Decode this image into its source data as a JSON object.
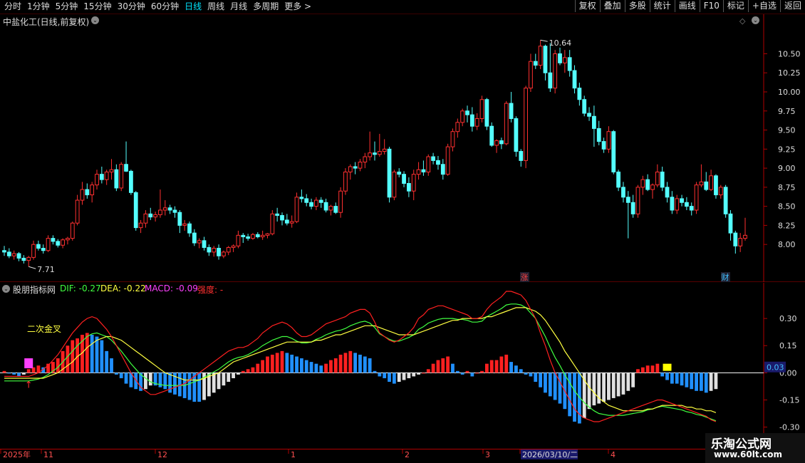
{
  "topbar": {
    "tabs": [
      {
        "label": "分时",
        "active": false
      },
      {
        "label": "1分钟",
        "active": false
      },
      {
        "label": "5分钟",
        "active": false
      },
      {
        "label": "15分钟",
        "active": false
      },
      {
        "label": "30分钟",
        "active": false
      },
      {
        "label": "60分钟",
        "active": false
      },
      {
        "label": "日线",
        "active": true
      },
      {
        "label": "周线",
        "active": false
      },
      {
        "label": "月线",
        "active": false
      },
      {
        "label": "多周期",
        "active": false
      },
      {
        "label": "更多 >",
        "active": false
      }
    ],
    "right_buttons": [
      "复权",
      "叠加",
      "多股",
      "统计",
      "画线",
      "F10",
      "标记",
      "+自选",
      "返回"
    ]
  },
  "main_chart": {
    "stock_title": "中盐化工(日线,前复权)",
    "high_marker": "10.64",
    "low_marker": "7.71",
    "event_badges": [
      {
        "text": "涨",
        "color": "#ff4040"
      },
      {
        "text": "财",
        "color": "#40c0ff"
      }
    ],
    "price_ticks": [
      "10.50",
      "10.25",
      "10.00",
      "9.75",
      "9.50",
      "9.25",
      "9.00",
      "8.75",
      "8.50",
      "8.25",
      "8.00"
    ],
    "colors": {
      "up": "#ff3030",
      "down": "#54ffff"
    }
  },
  "indicator": {
    "name": "股朋指标网",
    "dif_label": "DIF: -0.27",
    "dea_label": "DEA: -0.22",
    "macd_label": "MACD: -0.09",
    "strength_label": "强度: -",
    "annotation": "二次金叉",
    "current_value": "0.03",
    "ticks": [
      "0.30",
      "0.15",
      "0.00",
      "-0.15",
      "-0.30"
    ],
    "colors": {
      "dif": "#ff2020",
      "dea": "#ffff40",
      "mid": "#40ff40",
      "bar_up": "#ff2020",
      "bar_down": "#2090ff",
      "bar_weak": "#e0e0e0"
    }
  },
  "xaxis": {
    "labels": [
      "2025年",
      "11",
      "12",
      "1",
      "2",
      "3",
      "2026/03/10/二",
      "4"
    ]
  },
  "watermark": {
    "line1": "乐淘公式网",
    "line2": "www.60lt.com"
  },
  "chart_data": {
    "type": "candlestick",
    "ylim": [
      7.6,
      10.85
    ],
    "candles": [
      [
        7.92,
        7.98,
        7.85,
        7.9
      ],
      [
        7.9,
        7.95,
        7.82,
        7.85
      ],
      [
        7.85,
        7.92,
        7.8,
        7.88
      ],
      [
        7.88,
        7.9,
        7.78,
        7.82
      ],
      [
        7.82,
        7.86,
        7.75,
        7.79
      ],
      [
        7.79,
        7.85,
        7.71,
        7.83
      ],
      [
        7.83,
        8.05,
        7.8,
        8.0
      ],
      [
        8.0,
        8.05,
        7.92,
        7.95
      ],
      [
        7.95,
        8.0,
        7.88,
        7.92
      ],
      [
        7.92,
        8.12,
        7.9,
        8.08
      ],
      [
        8.08,
        8.12,
        8.0,
        8.04
      ],
      [
        8.04,
        8.07,
        7.96,
        7.99
      ],
      [
        7.99,
        8.08,
        7.95,
        8.06
      ],
      [
        8.06,
        8.1,
        8.0,
        8.08
      ],
      [
        8.08,
        8.3,
        8.05,
        8.28
      ],
      [
        8.28,
        8.65,
        8.25,
        8.58
      ],
      [
        8.58,
        8.82,
        8.52,
        8.72
      ],
      [
        8.72,
        8.8,
        8.6,
        8.65
      ],
      [
        8.65,
        8.82,
        8.55,
        8.78
      ],
      [
        8.78,
        8.98,
        8.72,
        8.92
      ],
      [
        8.92,
        9.02,
        8.8,
        8.85
      ],
      [
        8.85,
        8.98,
        8.78,
        8.95
      ],
      [
        8.95,
        9.12,
        8.85,
        8.98
      ],
      [
        8.98,
        9.05,
        8.7,
        8.74
      ],
      [
        8.74,
        9.08,
        8.7,
        9.05
      ],
      [
        9.05,
        9.35,
        8.95,
        8.96
      ],
      [
        8.96,
        8.98,
        8.65,
        8.68
      ],
      [
        8.68,
        8.7,
        8.18,
        8.22
      ],
      [
        8.22,
        8.32,
        8.15,
        8.28
      ],
      [
        8.28,
        8.45,
        8.22,
        8.4
      ],
      [
        8.4,
        8.48,
        8.32,
        8.36
      ],
      [
        8.36,
        8.43,
        8.3,
        8.39
      ],
      [
        8.39,
        8.72,
        8.35,
        8.45
      ],
      [
        8.45,
        8.58,
        8.38,
        8.48
      ],
      [
        8.48,
        8.52,
        8.4,
        8.45
      ],
      [
        8.45,
        8.5,
        8.35,
        8.42
      ],
      [
        8.42,
        8.45,
        8.15,
        8.25
      ],
      [
        8.25,
        8.32,
        8.18,
        8.27
      ],
      [
        8.27,
        8.3,
        8.1,
        8.15
      ],
      [
        8.15,
        8.2,
        7.98,
        8.02
      ],
      [
        8.02,
        8.08,
        7.95,
        8.05
      ],
      [
        8.05,
        8.1,
        7.92,
        7.96
      ],
      [
        7.96,
        8.0,
        7.85,
        7.9
      ],
      [
        7.9,
        7.98,
        7.84,
        7.95
      ],
      [
        7.95,
        8.0,
        7.8,
        7.85
      ],
      [
        7.85,
        7.92,
        7.82,
        7.9
      ],
      [
        7.9,
        7.98,
        7.86,
        7.96
      ],
      [
        7.96,
        8.0,
        7.9,
        7.98
      ],
      [
        7.98,
        8.18,
        7.95,
        8.12
      ],
      [
        8.12,
        8.15,
        8.02,
        8.1
      ],
      [
        8.1,
        8.14,
        8.05,
        8.08
      ],
      [
        8.08,
        8.15,
        8.06,
        8.13
      ],
      [
        8.13,
        8.16,
        8.08,
        8.1
      ],
      [
        8.1,
        8.18,
        8.06,
        8.12
      ],
      [
        8.12,
        8.15,
        8.08,
        8.14
      ],
      [
        8.14,
        8.45,
        8.12,
        8.4
      ],
      [
        8.4,
        8.48,
        8.3,
        8.38
      ],
      [
        8.38,
        8.42,
        8.25,
        8.32
      ],
      [
        8.32,
        8.4,
        8.25,
        8.28
      ],
      [
        8.28,
        8.38,
        8.22,
        8.3
      ],
      [
        8.3,
        8.68,
        8.28,
        8.62
      ],
      [
        8.62,
        8.72,
        8.55,
        8.6
      ],
      [
        8.6,
        8.66,
        8.5,
        8.55
      ],
      [
        8.55,
        8.6,
        8.46,
        8.5
      ],
      [
        8.5,
        8.62,
        8.45,
        8.58
      ],
      [
        8.58,
        8.62,
        8.48,
        8.55
      ],
      [
        8.55,
        8.6,
        8.42,
        8.45
      ],
      [
        8.45,
        8.52,
        8.38,
        8.5
      ],
      [
        8.5,
        8.55,
        8.4,
        8.42
      ],
      [
        8.42,
        8.75,
        8.35,
        8.7
      ],
      [
        8.7,
        9.0,
        8.65,
        8.95
      ],
      [
        8.95,
        9.05,
        8.85,
        9.02
      ],
      [
        9.02,
        9.08,
        8.92,
        9.0
      ],
      [
        9.0,
        9.12,
        8.96,
        9.08
      ],
      [
        9.08,
        9.2,
        9.0,
        9.15
      ],
      [
        9.15,
        9.48,
        9.1,
        9.2
      ],
      [
        9.2,
        9.35,
        9.1,
        9.18
      ],
      [
        9.18,
        9.45,
        9.15,
        9.22
      ],
      [
        9.22,
        9.38,
        9.18,
        9.25
      ],
      [
        9.25,
        9.28,
        8.55,
        8.62
      ],
      [
        8.62,
        8.98,
        8.58,
        8.95
      ],
      [
        8.95,
        9.0,
        8.88,
        8.92
      ],
      [
        8.92,
        8.96,
        8.75,
        8.8
      ],
      [
        8.8,
        8.88,
        8.62,
        8.7
      ],
      [
        8.7,
        8.98,
        8.58,
        8.92
      ],
      [
        8.92,
        9.08,
        8.85,
        8.98
      ],
      [
        8.98,
        9.1,
        8.9,
        8.95
      ],
      [
        8.95,
        9.18,
        8.9,
        9.15
      ],
      [
        9.15,
        9.2,
        9.05,
        9.1
      ],
      [
        9.1,
        9.16,
        8.98,
        9.05
      ],
      [
        9.05,
        9.12,
        8.85,
        8.92
      ],
      [
        8.92,
        9.32,
        8.9,
        9.28
      ],
      [
        9.28,
        9.52,
        9.22,
        9.48
      ],
      [
        9.48,
        9.65,
        9.4,
        9.6
      ],
      [
        9.6,
        9.78,
        9.55,
        9.75
      ],
      [
        9.75,
        9.82,
        9.6,
        9.7
      ],
      [
        9.7,
        9.8,
        9.48,
        9.55
      ],
      [
        9.55,
        9.72,
        9.5,
        9.65
      ],
      [
        9.65,
        9.95,
        9.6,
        9.9
      ],
      [
        9.9,
        9.92,
        9.5,
        9.55
      ],
      [
        9.55,
        9.6,
        9.28,
        9.3
      ],
      [
        9.3,
        9.38,
        9.2,
        9.36
      ],
      [
        9.36,
        9.4,
        9.25,
        9.32
      ],
      [
        9.32,
        9.88,
        9.3,
        9.85
      ],
      [
        9.85,
        10.0,
        9.6,
        9.65
      ],
      [
        9.65,
        9.68,
        9.15,
        9.22
      ],
      [
        9.22,
        9.25,
        9.02,
        9.1
      ],
      [
        9.1,
        10.08,
        9.0,
        10.05
      ],
      [
        10.05,
        10.5,
        10.0,
        10.4
      ],
      [
        10.4,
        10.5,
        10.3,
        10.35
      ],
      [
        10.35,
        10.68,
        10.3,
        10.6
      ],
      [
        10.6,
        10.62,
        10.15,
        10.25
      ],
      [
        10.25,
        10.64,
        10.0,
        10.05
      ],
      [
        10.05,
        10.55,
        9.98,
        10.5
      ],
      [
        10.5,
        10.58,
        10.35,
        10.38
      ],
      [
        10.38,
        10.55,
        10.25,
        10.45
      ],
      [
        10.45,
        10.55,
        10.2,
        10.28
      ],
      [
        10.28,
        10.35,
        9.98,
        10.05
      ],
      [
        10.05,
        10.12,
        9.82,
        9.9
      ],
      [
        9.9,
        9.95,
        9.68,
        9.72
      ],
      [
        9.72,
        9.8,
        9.62,
        9.68
      ],
      [
        9.68,
        9.82,
        9.28,
        9.52
      ],
      [
        9.52,
        9.62,
        9.3,
        9.35
      ],
      [
        9.35,
        9.4,
        9.2,
        9.25
      ],
      [
        9.25,
        9.55,
        9.2,
        9.48
      ],
      [
        9.48,
        9.5,
        8.92,
        8.95
      ],
      [
        8.95,
        8.98,
        8.7,
        8.75
      ],
      [
        8.75,
        8.82,
        8.55,
        8.62
      ],
      [
        8.62,
        8.7,
        8.08,
        8.55
      ],
      [
        8.55,
        8.65,
        8.35,
        8.4
      ],
      [
        8.4,
        8.78,
        8.35,
        8.75
      ],
      [
        8.75,
        8.9,
        8.65,
        8.85
      ],
      [
        8.85,
        8.92,
        8.7,
        8.72
      ],
      [
        8.72,
        8.8,
        8.6,
        8.78
      ],
      [
        8.78,
        9.05,
        8.75,
        8.95
      ],
      [
        8.95,
        9.02,
        8.7,
        8.75
      ],
      [
        8.75,
        8.82,
        8.55,
        8.62
      ],
      [
        8.62,
        8.7,
        8.4,
        8.45
      ],
      [
        8.45,
        8.65,
        8.4,
        8.6
      ],
      [
        8.6,
        8.65,
        8.5,
        8.55
      ],
      [
        8.55,
        8.62,
        8.45,
        8.5
      ],
      [
        8.5,
        8.55,
        8.38,
        8.45
      ],
      [
        8.45,
        8.82,
        8.4,
        8.78
      ],
      [
        8.78,
        9.05,
        8.75,
        8.82
      ],
      [
        8.82,
        8.95,
        8.7,
        8.72
      ],
      [
        8.72,
        8.98,
        8.7,
        8.9
      ],
      [
        8.9,
        8.92,
        8.6,
        8.65
      ],
      [
        8.65,
        8.78,
        8.6,
        8.75
      ],
      [
        8.75,
        8.78,
        8.35,
        8.4
      ],
      [
        8.4,
        8.45,
        8.05,
        8.15
      ],
      [
        8.15,
        8.18,
        7.88,
        7.98
      ],
      [
        7.98,
        8.15,
        7.9,
        8.08
      ],
      [
        8.08,
        8.35,
        8.05,
        8.12
      ]
    ],
    "macd_hist": [
      0.01,
      0.0,
      -0.01,
      -0.02,
      -0.01,
      0.02,
      0.03,
      0.04,
      0.03,
      0.05,
      0.06,
      0.08,
      0.12,
      0.15,
      0.18,
      0.19,
      0.21,
      0.22,
      0.21,
      0.2,
      0.18,
      0.12,
      0.08,
      -0.01,
      -0.03,
      -0.06,
      -0.08,
      -0.09,
      -0.1,
      -0.09,
      -0.07,
      -0.07,
      -0.08,
      -0.09,
      -0.11,
      -0.12,
      -0.13,
      -0.14,
      -0.15,
      -0.16,
      -0.16,
      -0.15,
      -0.13,
      -0.11,
      -0.09,
      -0.07,
      -0.05,
      -0.03,
      -0.01,
      0.01,
      0.02,
      0.03,
      0.05,
      0.07,
      0.09,
      0.1,
      0.11,
      0.12,
      0.11,
      0.1,
      0.09,
      0.08,
      0.07,
      0.06,
      0.05,
      0.04,
      0.05,
      0.07,
      0.08,
      0.1,
      0.11,
      0.12,
      0.11,
      0.1,
      0.09,
      0.08,
      0.01,
      -0.02,
      -0.03,
      -0.05,
      -0.06,
      -0.05,
      -0.04,
      -0.03,
      -0.02,
      -0.01,
      0.0,
      0.02,
      0.05,
      0.07,
      0.08,
      0.09,
      0.05,
      0.01,
      -0.01,
      0.01,
      -0.02,
      0.0,
      0.01,
      0.05,
      0.07,
      0.07,
      0.09,
      0.1,
      0.06,
      0.04,
      0.02,
      -0.01,
      -0.02,
      -0.05,
      -0.08,
      -0.11,
      -0.13,
      -0.15,
      -0.17,
      -0.2,
      -0.24,
      -0.27,
      -0.28,
      -0.25,
      -0.2,
      -0.18,
      -0.17,
      -0.16,
      -0.15,
      -0.14,
      -0.13,
      -0.12,
      -0.1,
      -0.08,
      0.02,
      0.03,
      0.04,
      0.04,
      0.05,
      -0.02,
      -0.04,
      -0.06,
      -0.06,
      -0.07,
      -0.08,
      -0.09,
      -0.1,
      -0.1,
      -0.11,
      -0.1,
      -0.09
    ],
    "dif": [
      -0.02,
      -0.02,
      -0.02,
      -0.02,
      -0.02,
      -0.02,
      -0.01,
      0.0,
      0.02,
      0.04,
      0.07,
      0.1,
      0.14,
      0.18,
      0.22,
      0.25,
      0.28,
      0.3,
      0.31,
      0.3,
      0.27,
      0.24,
      0.2,
      0.15,
      0.1,
      0.05,
      0.0,
      -0.04,
      -0.08,
      -0.1,
      -0.12,
      -0.12,
      -0.11,
      -0.1,
      -0.09,
      -0.08,
      -0.07,
      -0.06,
      -0.04,
      -0.02,
      0.0,
      0.02,
      0.04,
      0.06,
      0.08,
      0.1,
      0.12,
      0.13,
      0.14,
      0.14,
      0.15,
      0.17,
      0.19,
      0.22,
      0.24,
      0.26,
      0.27,
      0.28,
      0.27,
      0.25,
      0.22,
      0.2,
      0.2,
      0.21,
      0.23,
      0.25,
      0.27,
      0.28,
      0.29,
      0.3,
      0.31,
      0.33,
      0.34,
      0.35,
      0.35,
      0.33,
      0.28,
      0.22,
      0.2,
      0.18,
      0.17,
      0.18,
      0.2,
      0.22,
      0.25,
      0.3,
      0.32,
      0.35,
      0.36,
      0.37,
      0.37,
      0.36,
      0.35,
      0.34,
      0.33,
      0.32,
      0.3,
      0.3,
      0.31,
      0.35,
      0.38,
      0.4,
      0.42,
      0.45,
      0.45,
      0.44,
      0.43,
      0.4,
      0.35,
      0.3,
      0.22,
      0.15,
      0.07,
      0.0,
      -0.05,
      -0.1,
      -0.15,
      -0.2,
      -0.23,
      -0.25,
      -0.26,
      -0.27,
      -0.27,
      -0.26,
      -0.25,
      -0.24,
      -0.23,
      -0.22,
      -0.21,
      -0.2,
      -0.19,
      -0.18,
      -0.17,
      -0.16,
      -0.15,
      -0.15,
      -0.16,
      -0.17,
      -0.18,
      -0.19,
      -0.2,
      -0.21,
      -0.22,
      -0.23,
      -0.24,
      -0.26,
      -0.27
    ],
    "dea": [
      -0.03,
      -0.03,
      -0.03,
      -0.03,
      -0.03,
      -0.03,
      -0.03,
      -0.03,
      -0.03,
      -0.02,
      -0.01,
      0.0,
      0.02,
      0.04,
      0.06,
      0.09,
      0.11,
      0.14,
      0.16,
      0.18,
      0.19,
      0.2,
      0.2,
      0.19,
      0.18,
      0.16,
      0.14,
      0.12,
      0.1,
      0.08,
      0.06,
      0.04,
      0.02,
      0.0,
      -0.01,
      -0.02,
      -0.03,
      -0.04,
      -0.04,
      -0.04,
      -0.04,
      -0.03,
      -0.02,
      -0.01,
      0.0,
      0.02,
      0.04,
      0.06,
      0.07,
      0.08,
      0.09,
      0.1,
      0.11,
      0.12,
      0.13,
      0.14,
      0.15,
      0.16,
      0.17,
      0.17,
      0.17,
      0.17,
      0.17,
      0.17,
      0.18,
      0.18,
      0.19,
      0.2,
      0.21,
      0.21,
      0.22,
      0.23,
      0.24,
      0.25,
      0.26,
      0.26,
      0.26,
      0.25,
      0.24,
      0.23,
      0.22,
      0.21,
      0.21,
      0.21,
      0.21,
      0.22,
      0.23,
      0.24,
      0.25,
      0.26,
      0.27,
      0.28,
      0.29,
      0.29,
      0.3,
      0.3,
      0.3,
      0.3,
      0.3,
      0.31,
      0.31,
      0.32,
      0.33,
      0.34,
      0.35,
      0.36,
      0.36,
      0.36,
      0.35,
      0.34,
      0.32,
      0.29,
      0.25,
      0.21,
      0.17,
      0.12,
      0.08,
      0.04,
      0.0,
      -0.04,
      -0.08,
      -0.11,
      -0.14,
      -0.16,
      -0.18,
      -0.19,
      -0.2,
      -0.21,
      -0.21,
      -0.21,
      -0.21,
      -0.21,
      -0.2,
      -0.2,
      -0.19,
      -0.18,
      -0.18,
      -0.18,
      -0.18,
      -0.18,
      -0.19,
      -0.19,
      -0.2,
      -0.2,
      -0.21,
      -0.21,
      -0.22
    ]
  }
}
